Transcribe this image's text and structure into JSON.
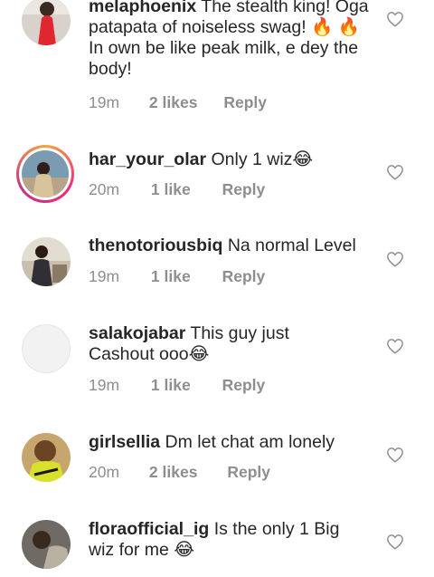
{
  "comments": [
    {
      "username": "melaphoenix",
      "text": "The stealth king! Oga patapata of noiseless swag! 🔥 🔥 In own be like peak milk, e dey the body!",
      "time": "19m",
      "likes": "2 likes",
      "reply": "Reply"
    },
    {
      "username": "har_your_olar",
      "text": "Only 1 wiz😂",
      "time": "20m",
      "likes": "1 like",
      "reply": "Reply"
    },
    {
      "username": "thenotoriousbiq",
      "text": "Na normal Level",
      "time": "19m",
      "likes": "1 like",
      "reply": "Reply"
    },
    {
      "username": "salakojabar",
      "text": "This guy just Cashout ooo😂",
      "time": "19m",
      "likes": "1 like",
      "reply": "Reply"
    },
    {
      "username": "girlsellia",
      "text": "Dm let chat am lonely",
      "time": "20m",
      "likes": "2 likes",
      "reply": "Reply"
    },
    {
      "username": "floraofficial_ig",
      "text": "Is the only 1 Big wiz for me 😂",
      "time": "",
      "likes": "",
      "reply": ""
    }
  ],
  "icons": {
    "like": "heart-outline-icon"
  },
  "colors": {
    "text": "#262626",
    "meta": "#8e8e8e",
    "story_ring_start": "#f9a33b",
    "story_ring_end": "#c13584"
  }
}
